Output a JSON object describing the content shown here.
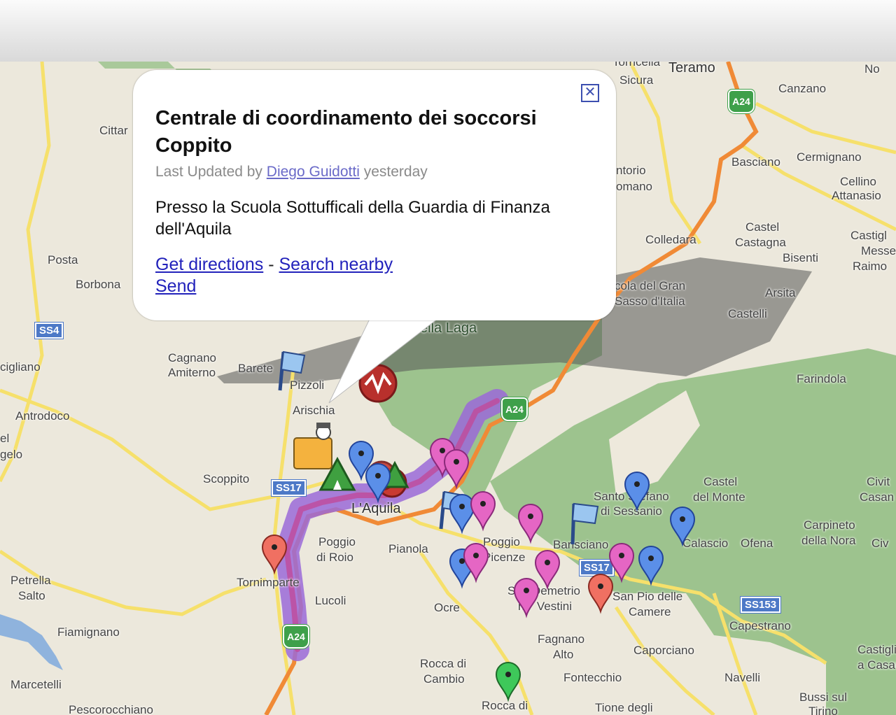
{
  "popup": {
    "title": "Centrale di coordinamento dei soccorsi Coppito",
    "meta_prefix": "Last Updated by",
    "author": "Diego Guidotti",
    "meta_suffix": "yesterday",
    "description": "Presso la Scuola Sottufficali della Guardia di Finanza dell'Aquila",
    "link_directions": "Get directions",
    "link_separator": "-",
    "link_search": "Search nearby",
    "link_send": "Send",
    "close_icon": "close-icon"
  },
  "map": {
    "colors": {
      "land": "#ece8dc",
      "park": "#9dc38e",
      "motorway": "#f08a36",
      "route_highlight": "#9b6ad8",
      "road_yellow": "#f6e06b",
      "pin_blue": "#5b8fe8",
      "pin_pink": "#e566c4",
      "pin_red": "#f07062",
      "pin_green": "#3ec85a"
    },
    "labels": {
      "teramo": "Teramo",
      "torricella": "Torricella",
      "sicura": "Sicura",
      "canzano": "Canzano",
      "no": "No",
      "cittareale": "Cittar",
      "basciano": "Basciano",
      "cermignano": "Cermignano",
      "cellino": "Cellino",
      "attanasio": "Attanasio",
      "montorio1": "ntorio",
      "montorio2": "omano",
      "castel_castagna1": "Castel",
      "castel_castagna2": "Castagna",
      "colledara": "Colledara",
      "castiglione1": "Castigl",
      "castiglione2": "Messe",
      "castiglione3": "Raimo",
      "bisenti": "Bisenti",
      "posta": "Posta",
      "borbona": "Borbona",
      "gran_sasso1": "cola del Gran",
      "gran_sasso2": "Sasso d'Italia",
      "arsita": "Arsita",
      "castelli": "Castelli",
      "laga": "ella Laga",
      "cagnano1": "Cagnano",
      "cagnano2": "Amiterno",
      "barete": "Barete",
      "pizzoli": "Pizzoli",
      "cigliano": "cigliano",
      "arischia": "Arischia",
      "farindola": "Farindola",
      "antrodoco": "Antrodoco",
      "el": "el",
      "gelo": "gelo",
      "scoppito": "Scoppito",
      "laquila": "L'Aquila",
      "santo_stefano1": "Santo Stefano",
      "santo_stefano2": "di Sessanio",
      "castel_monte1": "Castel",
      "castel_monte2": "del Monte",
      "civitella1": "Civit",
      "civitella2": "Casan",
      "carpineto1": "Carpineto",
      "carpineto2": "della Nora",
      "poggio_roio1": "Poggio",
      "poggio_roio2": "di Roio",
      "pianola": "Pianola",
      "poggio_picenze1": "Poggio",
      "poggio_picenze2": "Picenze",
      "barisciano": "Barisciano",
      "calascio": "Calascio",
      "ofena": "Ofena",
      "civ": "Civ",
      "petrella1": "Petrella",
      "petrella2": "Salto",
      "tornimparte": "Tornimparte",
      "lucoli": "Lucoli",
      "ocre": "Ocre",
      "demetrio1": "San Demetrio",
      "demetrio2": "ne' Vestini",
      "san_pio1": "San Pio delle",
      "san_pio2": "Camere",
      "capestrano": "Capestrano",
      "fiamignano": "Fiamignano",
      "fagnano1": "Fagnano",
      "fagnano2": "Alto",
      "caporciano": "Caporciano",
      "castiglione_c1": "Castiglione",
      "castiglione_c2": "a Casauria",
      "marcetelli": "Marcetelli",
      "rocca_cambio1": "Rocca di",
      "rocca_cambio2": "Cambio",
      "fontecchio": "Fontecchio",
      "navelli": "Navelli",
      "bussi1": "Bussi sul",
      "bussi2": "Tirino",
      "pescorocchiano": "Pescorocchiano",
      "rocca_mezzo": "Rocca di",
      "tione": "Tione degli"
    },
    "shields": {
      "ss4": "SS4",
      "ss17": "SS17",
      "ss153": "SS153",
      "ss_center": "SS17",
      "a24_top": "A24",
      "a24_mid": "A24",
      "a24_bottom": "A24"
    }
  }
}
